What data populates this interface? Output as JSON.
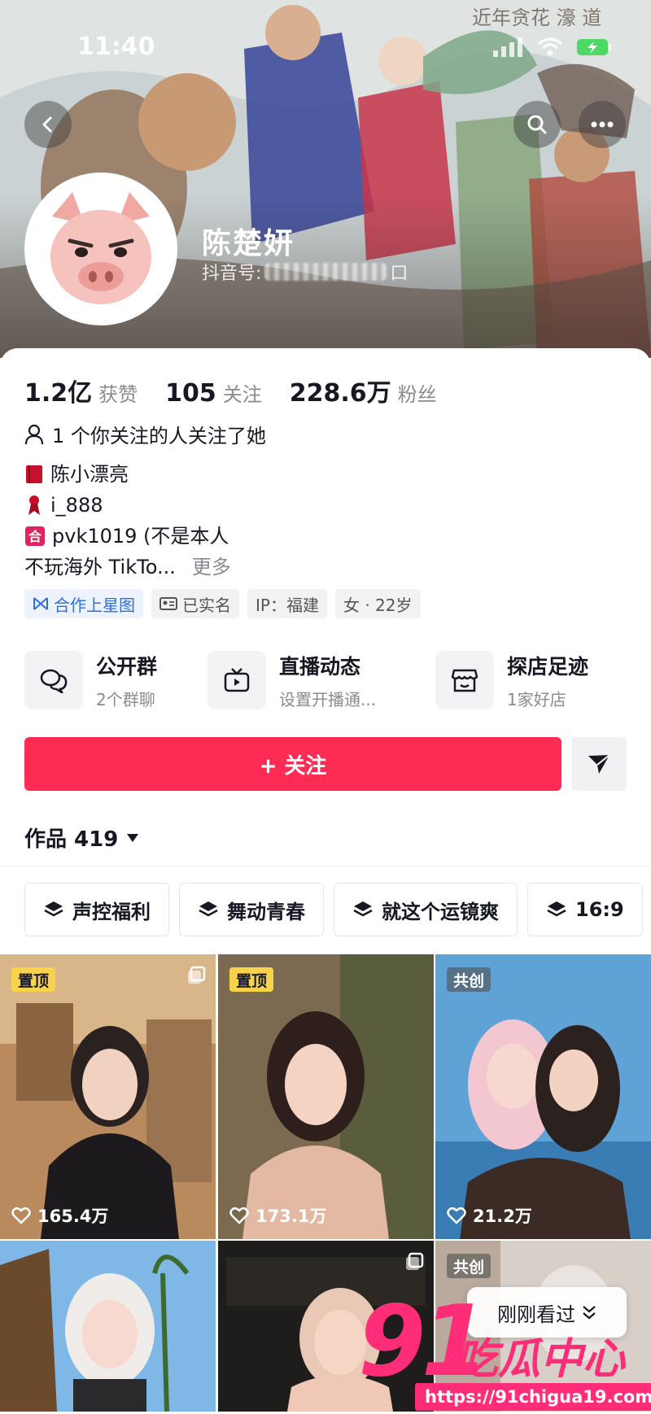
{
  "status_bar": {
    "time": "11:40"
  },
  "profile": {
    "nickname": "陈楚妍",
    "douyin_id_label": "抖音号:",
    "douyin_id_tail": "口"
  },
  "stats": [
    {
      "value": "1.2亿",
      "label": "获赞"
    },
    {
      "value": "105",
      "label": "关注"
    },
    {
      "value": "228.6万",
      "label": "粉丝"
    }
  ],
  "mutual_follow": "1 个你关注的人关注了她",
  "bio": {
    "line1": "陈小漂亮",
    "line2": "i_888",
    "line3": "pvk1019 (不是本人",
    "line4": "不玩海外 TikTo...",
    "more": "更多"
  },
  "tags": {
    "cooperation": "合作上星图",
    "verified": "已实名",
    "ip": "IP：福建",
    "gender_age": "女 · 22岁"
  },
  "services": [
    {
      "title": "公开群",
      "subtitle": "2个群聊"
    },
    {
      "title": "直播动态",
      "subtitle": "设置开播通..."
    },
    {
      "title": "探店足迹",
      "subtitle": "1家好店"
    }
  ],
  "follow_button": "+ 关注",
  "works": {
    "label": "作品 419"
  },
  "collections": [
    "声控福利",
    "舞动青春",
    "就这个运镜爽",
    "16:9"
  ],
  "videos": [
    {
      "badge": "置顶",
      "likes": "165.4万"
    },
    {
      "badge": "置顶",
      "likes": "173.1万"
    },
    {
      "badge": "共创",
      "likes": "21.2万"
    },
    {
      "badge": "",
      "likes": ""
    },
    {
      "badge": "",
      "likes": ""
    },
    {
      "badge": "共创",
      "likes": ""
    }
  ],
  "just_seen": "刚刚看过",
  "watermark": {
    "logo_number": "91",
    "logo_text": "吃瓜中心",
    "url": "https://91chigua19.com"
  },
  "colors": {
    "accent": "#fe2c55",
    "pin_badge": "#f8d24a",
    "watermark": "#ff2d78"
  }
}
